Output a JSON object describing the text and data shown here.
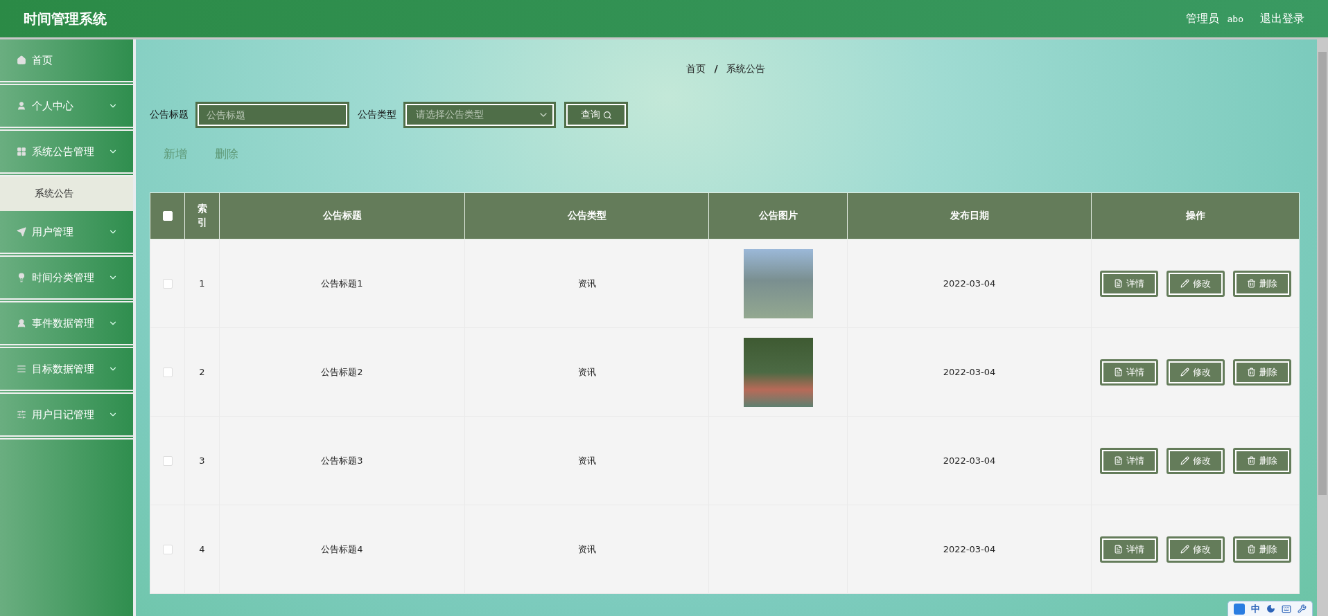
{
  "header": {
    "title": "时间管理系统",
    "user_role": "管理员",
    "user_name": "abo",
    "logout": "退出登录"
  },
  "sidebar": {
    "items": [
      {
        "label": "首页",
        "expandable": false
      },
      {
        "label": "个人中心",
        "expandable": true,
        "expanded": false
      },
      {
        "label": "系统公告管理",
        "expandable": true,
        "expanded": true,
        "children": [
          {
            "label": "系统公告",
            "selected": true
          }
        ]
      },
      {
        "label": "用户管理",
        "expandable": true,
        "expanded": false
      },
      {
        "label": "时间分类管理",
        "expandable": true,
        "expanded": false
      },
      {
        "label": "事件数据管理",
        "expandable": true,
        "expanded": false
      },
      {
        "label": "目标数据管理",
        "expandable": true,
        "expanded": false
      },
      {
        "label": "用户日记管理",
        "expandable": true,
        "expanded": false
      }
    ]
  },
  "breadcrumb": [
    "首页",
    "/",
    "系统公告"
  ],
  "search": {
    "title_label": "公告标题",
    "title_placeholder": "公告标题",
    "type_label": "公告类型",
    "type_placeholder": "请选择公告类型",
    "query_button": "查询"
  },
  "actions": [
    "新增",
    "删除"
  ],
  "table": {
    "select_all_checked": false,
    "columns": [
      "索引",
      "公告标题",
      "公告类型",
      "公告图片",
      "发布日期",
      "操作"
    ],
    "rows": [
      {
        "checked": false,
        "index": "1",
        "title": "公告标题1",
        "type": "资讯",
        "has_picture": true,
        "date": "2022-03-04",
        "buttons": [
          "详情",
          "修改",
          "删除"
        ]
      },
      {
        "checked": false,
        "index": "2",
        "title": "公告标题2",
        "type": "资讯",
        "has_picture": true,
        "date": "2022-03-04",
        "buttons": [
          "详情",
          "修改",
          "删除"
        ]
      },
      {
        "checked": false,
        "index": "3",
        "title": "公告标题3",
        "type": "资讯",
        "has_picture": false,
        "date": "2022-03-04",
        "buttons": [
          "详情",
          "修改",
          "删除"
        ]
      },
      {
        "checked": false,
        "index": "4",
        "title": "公告标题4",
        "type": "资讯",
        "has_picture": false,
        "date": "2022-03-04",
        "buttons": [
          "详情",
          "修改",
          "删除"
        ]
      }
    ]
  },
  "ime_toolbar": {
    "mode": "中"
  }
}
